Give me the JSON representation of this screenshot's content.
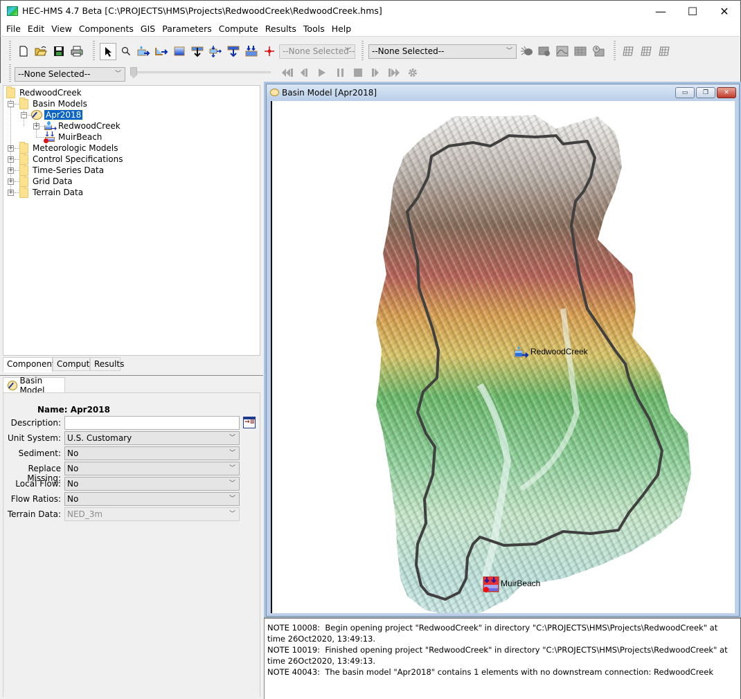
{
  "window": {
    "title": "HEC-HMS 4.7 Beta [C:\\PROJECTS\\HMS\\Projects\\RedwoodCreek\\RedwoodCreek.hms]",
    "icon": "hec-hms-app-icon",
    "minimize_glyph": "—",
    "maximize_glyph": "☐",
    "close_glyph": "✕"
  },
  "menu": [
    "File",
    "Edit",
    "View",
    "Components",
    "GIS",
    "Parameters",
    "Compute",
    "Results",
    "Tools",
    "Help"
  ],
  "toolbar": {
    "file_tools": [
      {
        "name": "new-icon",
        "glyph": "🗋"
      },
      {
        "name": "open-icon",
        "glyph": "📂"
      },
      {
        "name": "save-icon",
        "glyph": "💾"
      },
      {
        "name": "print-icon",
        "glyph": "🖶"
      }
    ],
    "element_tools": [
      {
        "name": "arrow-select-icon",
        "glyph": "↖",
        "selected": true
      },
      {
        "name": "zoom-tool-icon",
        "glyph": "⚲"
      },
      {
        "name": "subbasin-creator-icon",
        "glyph": "⤷"
      },
      {
        "name": "reach-creator-icon",
        "glyph": "↳"
      },
      {
        "name": "reservoir-creator-icon",
        "glyph": "▭"
      },
      {
        "name": "junction-creator-icon",
        "glyph": "⊻"
      },
      {
        "name": "diversion-creator-icon",
        "glyph": "⇅"
      },
      {
        "name": "source-creator-icon",
        "glyph": "⇩"
      },
      {
        "name": "sink-creator-icon",
        "glyph": "⇊"
      },
      {
        "name": "gage-location-icon",
        "glyph": "✛"
      }
    ],
    "element_selector": {
      "value": "--None Selected--",
      "disabled": true
    },
    "run_selector": {
      "value": "--None Selected--"
    },
    "result_tools": [
      {
        "name": "compute-bug-icon",
        "glyph": "✱"
      },
      {
        "name": "global-summary-icon",
        "glyph": "▦"
      },
      {
        "name": "graph-icon",
        "glyph": "◪"
      },
      {
        "name": "summary-table-icon",
        "glyph": "▤"
      },
      {
        "name": "time-series-table-icon",
        "glyph": "◷"
      }
    ],
    "grid_tools": [
      {
        "name": "grid-icon-1",
        "glyph": "⊞"
      },
      {
        "name": "grid-icon-2",
        "glyph": "⊞"
      },
      {
        "name": "grid-icon-3",
        "glyph": "⊞"
      }
    ],
    "animation_selector": {
      "value": "--None Selected--"
    },
    "animation_progress": 0,
    "playback": [
      {
        "name": "rewind-icon",
        "glyph": "◀◀▎"
      },
      {
        "name": "step-back-icon",
        "glyph": "◀▎"
      },
      {
        "name": "play-icon",
        "glyph": "▶"
      },
      {
        "name": "pause-icon",
        "glyph": "❚❚"
      },
      {
        "name": "stop-icon",
        "glyph": "■"
      },
      {
        "name": "step-forward-icon",
        "glyph": "▎▶"
      },
      {
        "name": "fast-forward-icon",
        "glyph": "▎▶▶"
      },
      {
        "name": "animation-settings-icon",
        "glyph": "⚙"
      }
    ]
  },
  "tree": {
    "root": "RedwoodCreek",
    "basin_models_label": "Basin Models",
    "basin_model": "Apr2018",
    "elements": [
      "RedwoodCreek",
      "MuirBeach"
    ],
    "folders": [
      "Meteorologic Models",
      "Control Specifications",
      "Time-Series Data",
      "Grid Data",
      "Terrain Data"
    ]
  },
  "left_tabs": [
    "Components",
    "Compute",
    "Results"
  ],
  "properties": {
    "tab_label": "Basin Model",
    "name_label": "Name:",
    "name_value": "Apr2018",
    "fields": [
      {
        "label": "Description:",
        "value": "",
        "type": "text"
      },
      {
        "label": "Unit System:",
        "value": "U.S. Customary",
        "type": "select"
      },
      {
        "label": "Sediment:",
        "value": "No",
        "type": "select"
      },
      {
        "label": "Replace Missing:",
        "value": "No",
        "type": "select"
      },
      {
        "label": "Local Flow:",
        "value": "No",
        "type": "select"
      },
      {
        "label": "Flow Ratios:",
        "value": "No",
        "type": "select"
      },
      {
        "label": "Terrain Data:",
        "value": "NED_3m",
        "type": "select",
        "disabled": true
      }
    ]
  },
  "basin_window": {
    "title": "Basin Model [Apr2018]",
    "elements": [
      {
        "name": "RedwoodCreek",
        "type": "subbasin"
      },
      {
        "name": "MuirBeach",
        "type": "sink"
      }
    ],
    "boundary_color": "#404040"
  },
  "log": [
    "NOTE 10008:  Begin opening project \"RedwoodCreek\" in directory \"C:\\PROJECTS\\HMS\\Projects\\RedwoodCreek\" at time 26Oct2020, 13:49:13.",
    "NOTE 10019:  Finished opening project \"RedwoodCreek\" in directory \"C:\\PROJECTS\\HMS\\Projects\\RedwoodCreek\" at time 26Oct2020, 13:49:13.",
    "NOTE 40043:  The basin model \"Apr2018\" contains 1 elements with no downstream connection: RedwoodCreek"
  ]
}
